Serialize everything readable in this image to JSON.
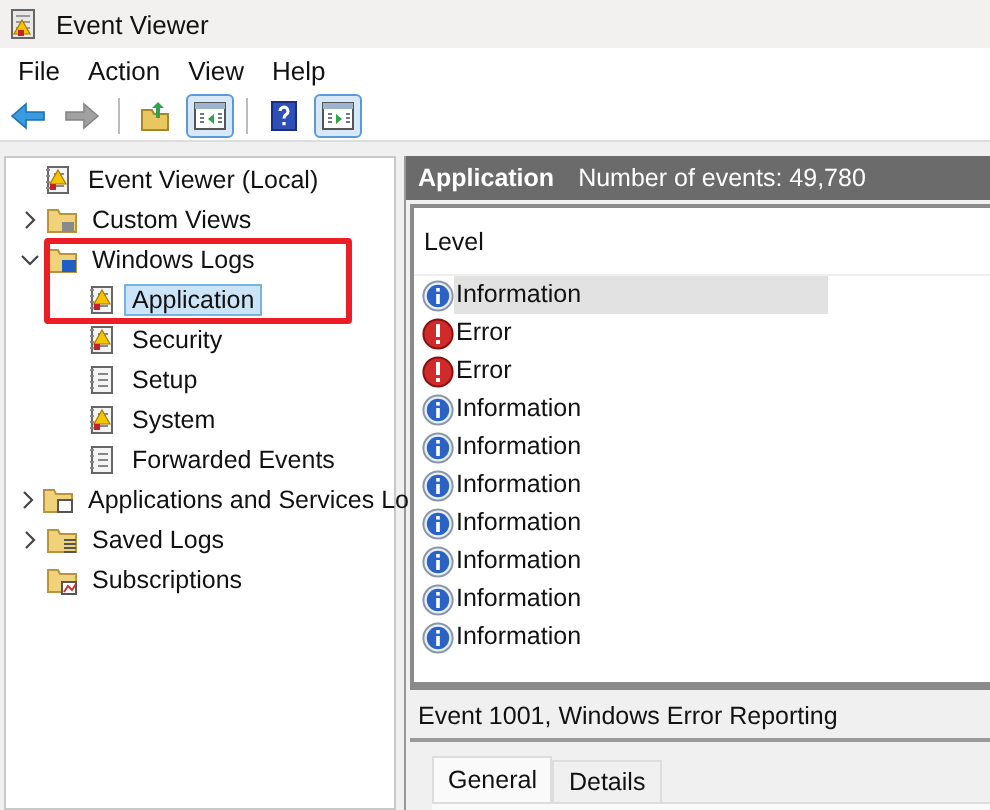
{
  "window": {
    "title": "Event Viewer"
  },
  "menu": [
    "File",
    "Action",
    "View",
    "Help"
  ],
  "toolbar": [
    {
      "kind": "back",
      "disabled": false,
      "pressed": false
    },
    {
      "kind": "forward",
      "disabled": true,
      "pressed": false
    },
    {
      "kind": "up",
      "disabled": false,
      "pressed": false
    },
    {
      "kind": "console-tree",
      "disabled": false,
      "pressed": true
    },
    {
      "kind": "help",
      "disabled": false,
      "pressed": false
    },
    {
      "kind": "action-pane",
      "disabled": false,
      "pressed": true
    }
  ],
  "tree": [
    {
      "label": "Event Viewer (Local)",
      "kind": "root",
      "selected": false,
      "children": [
        {
          "label": "Custom Views",
          "kind": "folder",
          "selected": false,
          "expanded": false
        },
        {
          "label": "Windows Logs",
          "kind": "folder-computer",
          "selected": false,
          "expanded": true,
          "children": [
            {
              "label": "Application",
              "kind": "log-warning",
              "selected": true
            },
            {
              "label": "Security",
              "kind": "log-warning",
              "selected": false
            },
            {
              "label": "Setup",
              "kind": "log",
              "selected": false
            },
            {
              "label": "System",
              "kind": "log-warning",
              "selected": false
            },
            {
              "label": "Forwarded Events",
              "kind": "log",
              "selected": false
            }
          ]
        },
        {
          "label": "Applications and Services Lo",
          "kind": "folder-window",
          "selected": false,
          "expanded": false
        },
        {
          "label": "Saved Logs",
          "kind": "folder-stack",
          "selected": false,
          "expanded": false
        },
        {
          "label": "Subscriptions",
          "kind": "folder-chart",
          "selected": false
        }
      ]
    }
  ],
  "log_header": {
    "name": "Application",
    "count": "Number of events: 49,780"
  },
  "table": {
    "columns": [
      "Level"
    ],
    "rows": [
      {
        "level": "Information",
        "kind": "information",
        "selected": true
      },
      {
        "level": "Error",
        "kind": "error",
        "selected": false
      },
      {
        "level": "Error",
        "kind": "error",
        "selected": false
      },
      {
        "level": "Information",
        "kind": "information",
        "selected": false
      },
      {
        "level": "Information",
        "kind": "information",
        "selected": false
      },
      {
        "level": "Information",
        "kind": "information",
        "selected": false
      },
      {
        "level": "Information",
        "kind": "information",
        "selected": false
      },
      {
        "level": "Information",
        "kind": "information",
        "selected": false
      },
      {
        "level": "Information",
        "kind": "information",
        "selected": false
      },
      {
        "level": "Information",
        "kind": "information",
        "selected": false
      }
    ]
  },
  "event_panel": {
    "title": "Event 1001, Windows Error Reporting",
    "tabs": [
      {
        "label": "General",
        "selected": true
      },
      {
        "label": "Details",
        "selected": false
      }
    ]
  }
}
